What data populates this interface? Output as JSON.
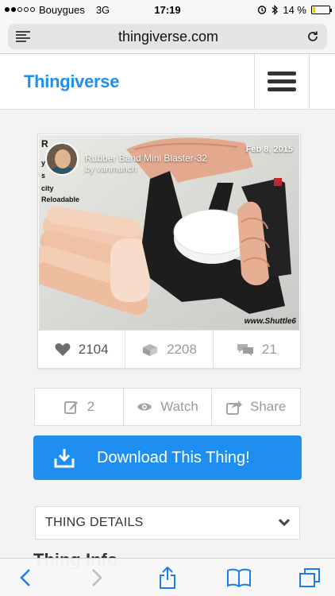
{
  "status_bar": {
    "carrier": "Bouygues",
    "network": "3G",
    "time": "17:19",
    "battery": "14 %",
    "battery_level": 0.14
  },
  "url_bar": {
    "url": "thingiverse.com",
    "reader_icon": "reader-icon",
    "reload_icon": "reload-icon"
  },
  "header": {
    "logo": "Thingiverse",
    "menu_icon": "hamburger-icon"
  },
  "thing": {
    "title": "Rubber Band Mini Blaster-32",
    "author": "by vanmunch",
    "date": "Feb 8, 2015",
    "watermark": "www.Shuttle6",
    "side_text": [
      "R",
      "y",
      "s",
      "city",
      "Reloadable"
    ],
    "stats": {
      "likes": "2104",
      "collections": "2208",
      "comments": "21"
    }
  },
  "actions": {
    "remixes": "2",
    "watch": "Watch",
    "share": "Share"
  },
  "download_label": "Download This Thing!",
  "details_label": "THING DETAILS",
  "cut_text": "Thing Info",
  "colors": {
    "accent": "#1f8ef1",
    "battery": "#f5c518"
  }
}
